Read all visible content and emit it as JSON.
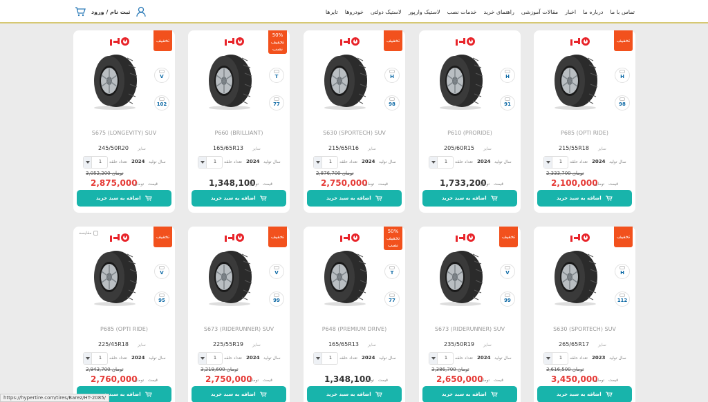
{
  "header": {
    "nav": [
      "تایرها",
      "خودروها",
      "لاستیک دولتی",
      "لاستیک وارپور",
      "خدمات نصب",
      "راهنمای خرید",
      "مقالات آموزشی",
      "اخبار",
      "درباره ما",
      "تماس با ما"
    ],
    "auth": "ثبت نام / ورود"
  },
  "common": {
    "size_label": "سایز",
    "year_label": "سال تولید",
    "qty_label": "تعداد حلقه",
    "price_label": "قیمت",
    "toman": "تومان",
    "add_to_cart": "اضافه به سبد خرید",
    "compare": "مقایسه"
  },
  "products": [
    {
      "title": "P685 (OPTI RIDE)",
      "size": "215/55R18",
      "year": "2024",
      "qty": "1",
      "old_price": "2,333,700 تومان",
      "price": "2,100,000",
      "sale": true,
      "badge": "تخفیف",
      "spec1": "H",
      "spec2": "98"
    },
    {
      "title": "P610 (PRORIDE)",
      "size": "205/60R15",
      "year": "2024",
      "qty": "1",
      "old_price": "",
      "price": "1,733,200",
      "sale": false,
      "badge": "",
      "spec1": "H",
      "spec2": "91"
    },
    {
      "title": "S630 (SPORTECH) SUV",
      "size": "215/65R16",
      "year": "2024",
      "qty": "1",
      "old_price": "2,876,700 تومان",
      "price": "2,750,000",
      "sale": true,
      "badge": "تخفیف",
      "spec1": "H",
      "spec2": "98"
    },
    {
      "title": "P660 (BRILLIANT)",
      "size": "165/65R13",
      "year": "2024",
      "qty": "1",
      "old_price": "",
      "price": "1,348,100",
      "sale": false,
      "badge": "50% تخفیف نصب",
      "spec1": "T",
      "spec2": "77"
    },
    {
      "title": "S675 (LONGEVITY) SUV",
      "size": "245/50R20",
      "year": "2024",
      "qty": "1",
      "old_price": "3,052,200 تومان",
      "price": "2,875,000",
      "sale": true,
      "badge": "تخفیف",
      "spec1": "V",
      "spec2": "102"
    },
    {
      "title": "S630 (SPORTECH) SUV",
      "size": "265/65R17",
      "year": "2023",
      "qty": "1",
      "old_price": "3,616,500 تومان",
      "price": "3,450,000",
      "sale": true,
      "badge": "تخفیف",
      "spec1": "H",
      "spec2": "112"
    },
    {
      "title": "S673 (RIDERUNNER) SUV",
      "size": "235/50R19",
      "year": "2024",
      "qty": "1",
      "old_price": "3,386,700 تومان",
      "price": "2,650,000",
      "sale": true,
      "badge": "تخفیف",
      "spec1": "V",
      "spec2": "99"
    },
    {
      "title": "P648 (PREMIUM DRIVE)",
      "size": "165/65R13",
      "year": "2024",
      "qty": "1",
      "old_price": "",
      "price": "1,348,100",
      "sale": false,
      "badge": "50% تخفیف نصب",
      "spec1": "T",
      "spec2": "77"
    },
    {
      "title": "S673 (RIDERUNNER) SUV",
      "size": "225/55R19",
      "year": "2024",
      "qty": "1",
      "old_price": "3,219,600 تومان",
      "price": "2,750,000",
      "sale": true,
      "badge": "تخفیف",
      "spec1": "V",
      "spec2": "99"
    },
    {
      "title": "P685 (OPTI RIDE)",
      "size": "225/45R18",
      "year": "2024",
      "qty": "1",
      "old_price": "2,943,700 تومان",
      "price": "2,760,000",
      "sale": true,
      "badge": "تخفیف",
      "spec1": "V",
      "spec2": "95",
      "compare": true
    }
  ],
  "status_url": "https://hypertire.com/tires/Barez/HT-2085/",
  "colors": {
    "accent": "#18b4ab",
    "badge": "#f2511d",
    "price_red": "#e53935",
    "brand": "#e8242a"
  }
}
